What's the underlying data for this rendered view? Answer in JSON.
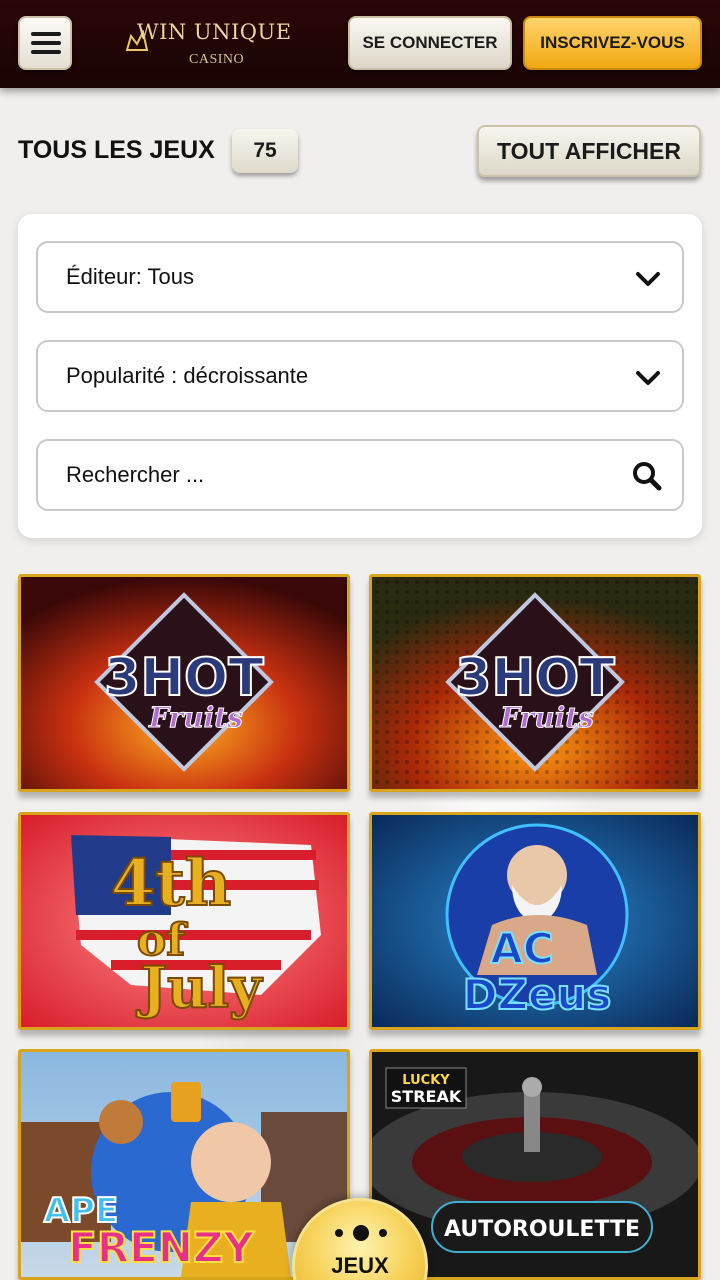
{
  "header": {
    "menu_icon": "hamburger-menu-icon",
    "logo_text": "WIN UNIQUE",
    "logo_subtext": "CASINO",
    "login_label": "SE CONNECTER",
    "signup_label": "INSCRIVEZ-VOUS"
  },
  "section": {
    "title": "TOUS LES JEUX",
    "count": "75",
    "show_all_label": "TOUT AFFICHER"
  },
  "filters": {
    "publisher": "Éditeur: Tous",
    "sort": "Popularité : décroissante",
    "search_placeholder": "Rechercher ..."
  },
  "games": [
    {
      "title_line1": "3HOT",
      "title_line2": "Fruits"
    },
    {
      "title_line1": "3HOT",
      "title_line2": "Fruits"
    },
    {
      "title_line1": "4th",
      "title_line2": "of",
      "title_line3": "July"
    },
    {
      "title_line1": "AC",
      "title_line2": "DZeus"
    },
    {
      "title_line1": "APE",
      "title_line2": "FRENZY"
    },
    {
      "badge_line1": "LUCKY",
      "badge_line2": "STREAK",
      "title_line1": "AUTOROULETTE"
    }
  ],
  "bottom_nav": {
    "games_label": "JEUX"
  },
  "colors": {
    "header_bg": "#1a0404",
    "accent_gold": "#f0a814",
    "tile_border": "#d8a41c"
  }
}
